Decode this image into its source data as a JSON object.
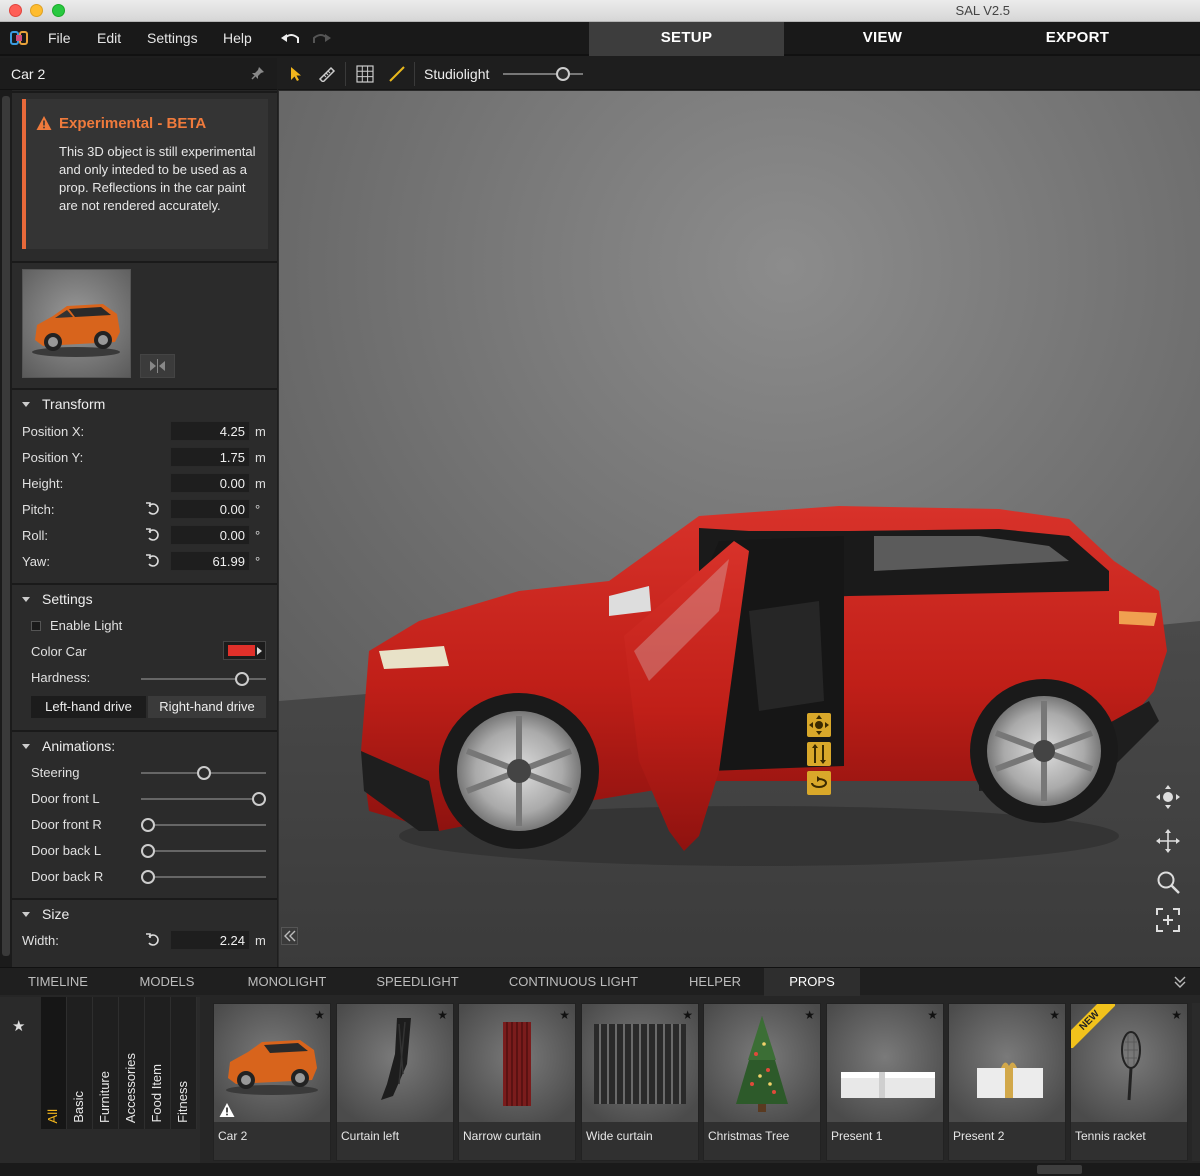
{
  "window": {
    "title": "SAL V2.5"
  },
  "menu": {
    "items": [
      "File",
      "Edit",
      "Settings",
      "Help"
    ]
  },
  "main_tabs": [
    {
      "label": "SETUP",
      "active": true
    },
    {
      "label": "VIEW",
      "active": false
    },
    {
      "label": "EXPORT",
      "active": false
    }
  ],
  "object_panel": {
    "title": "Car 2",
    "beta": {
      "title": "Experimental - BETA",
      "body": "This 3D object is still experimental and only inteded to be used as a prop. Reflections in the car paint are not rendered accurately."
    }
  },
  "transform": {
    "header": "Transform",
    "rows": [
      {
        "label": "Position X:",
        "value": "4.25",
        "unit": "m"
      },
      {
        "label": "Position Y:",
        "value": "1.75",
        "unit": "m"
      },
      {
        "label": "Height:",
        "value": "0.00",
        "unit": "m"
      },
      {
        "label": "Pitch:",
        "value": "0.00",
        "unit": "°"
      },
      {
        "label": "Roll:",
        "value": "0.00",
        "unit": "°"
      },
      {
        "label": "Yaw:",
        "value": "61.99",
        "unit": "°"
      }
    ]
  },
  "settings": {
    "header": "Settings",
    "enable_light": {
      "label": "Enable Light",
      "checked": false
    },
    "color_car": {
      "label": "Color Car",
      "color": "#e0302a"
    },
    "hardness": {
      "label": "Hardness:",
      "level": 0.85
    },
    "drive": {
      "left": "Left-hand drive",
      "right": "Right-hand drive",
      "selected": "left"
    }
  },
  "animations": {
    "header": "Animations:",
    "sliders": [
      {
        "label": "Steering",
        "level": 0.5
      },
      {
        "label": "Door front L",
        "level": 1.0
      },
      {
        "label": "Door front R",
        "level": 0.0
      },
      {
        "label": "Door back L",
        "level": 0.0
      },
      {
        "label": "Door back R",
        "level": 0.0
      }
    ]
  },
  "size": {
    "header": "Size",
    "width": {
      "label": "Width:",
      "value": "2.24",
      "unit": "m"
    }
  },
  "viewport_toolbar": {
    "preset": "Studiolight",
    "light_level": 0.8
  },
  "colors": {
    "accent_orange": "#ef7a3c",
    "gizmo_yellow": "#d9a82a",
    "car_red": "#c41f1a"
  },
  "bottom_tabs": [
    {
      "label": "TIMELINE",
      "active": false
    },
    {
      "label": "MODELS",
      "active": false
    },
    {
      "label": "MONOLIGHT",
      "active": false
    },
    {
      "label": "SPEEDLIGHT",
      "active": false
    },
    {
      "label": "CONTINUOUS LIGHT",
      "active": false
    },
    {
      "label": "HELPER",
      "active": false
    },
    {
      "label": "PROPS",
      "active": true
    }
  ],
  "categories": [
    {
      "label": "All",
      "active": true
    },
    {
      "label": "Basic",
      "active": false
    },
    {
      "label": "Furniture",
      "active": false
    },
    {
      "label": "Accessories",
      "active": false
    },
    {
      "label": "Food Item",
      "active": false
    },
    {
      "label": "Fitness",
      "active": false
    }
  ],
  "props": [
    {
      "label": "Car 2",
      "icon": "car-thumbnail"
    },
    {
      "label": "Curtain left",
      "icon": "curtain-icon"
    },
    {
      "label": "Narrow curtain",
      "icon": "curtain-icon"
    },
    {
      "label": "Wide curtain",
      "icon": "curtain-icon"
    },
    {
      "label": "Christmas Tree",
      "icon": "tree-icon"
    },
    {
      "label": "Present 1",
      "icon": "present-icon"
    },
    {
      "label": "Present 2",
      "icon": "present-icon"
    },
    {
      "label": "Tennis racket",
      "icon": "racket-icon",
      "badge": "NEW"
    }
  ]
}
